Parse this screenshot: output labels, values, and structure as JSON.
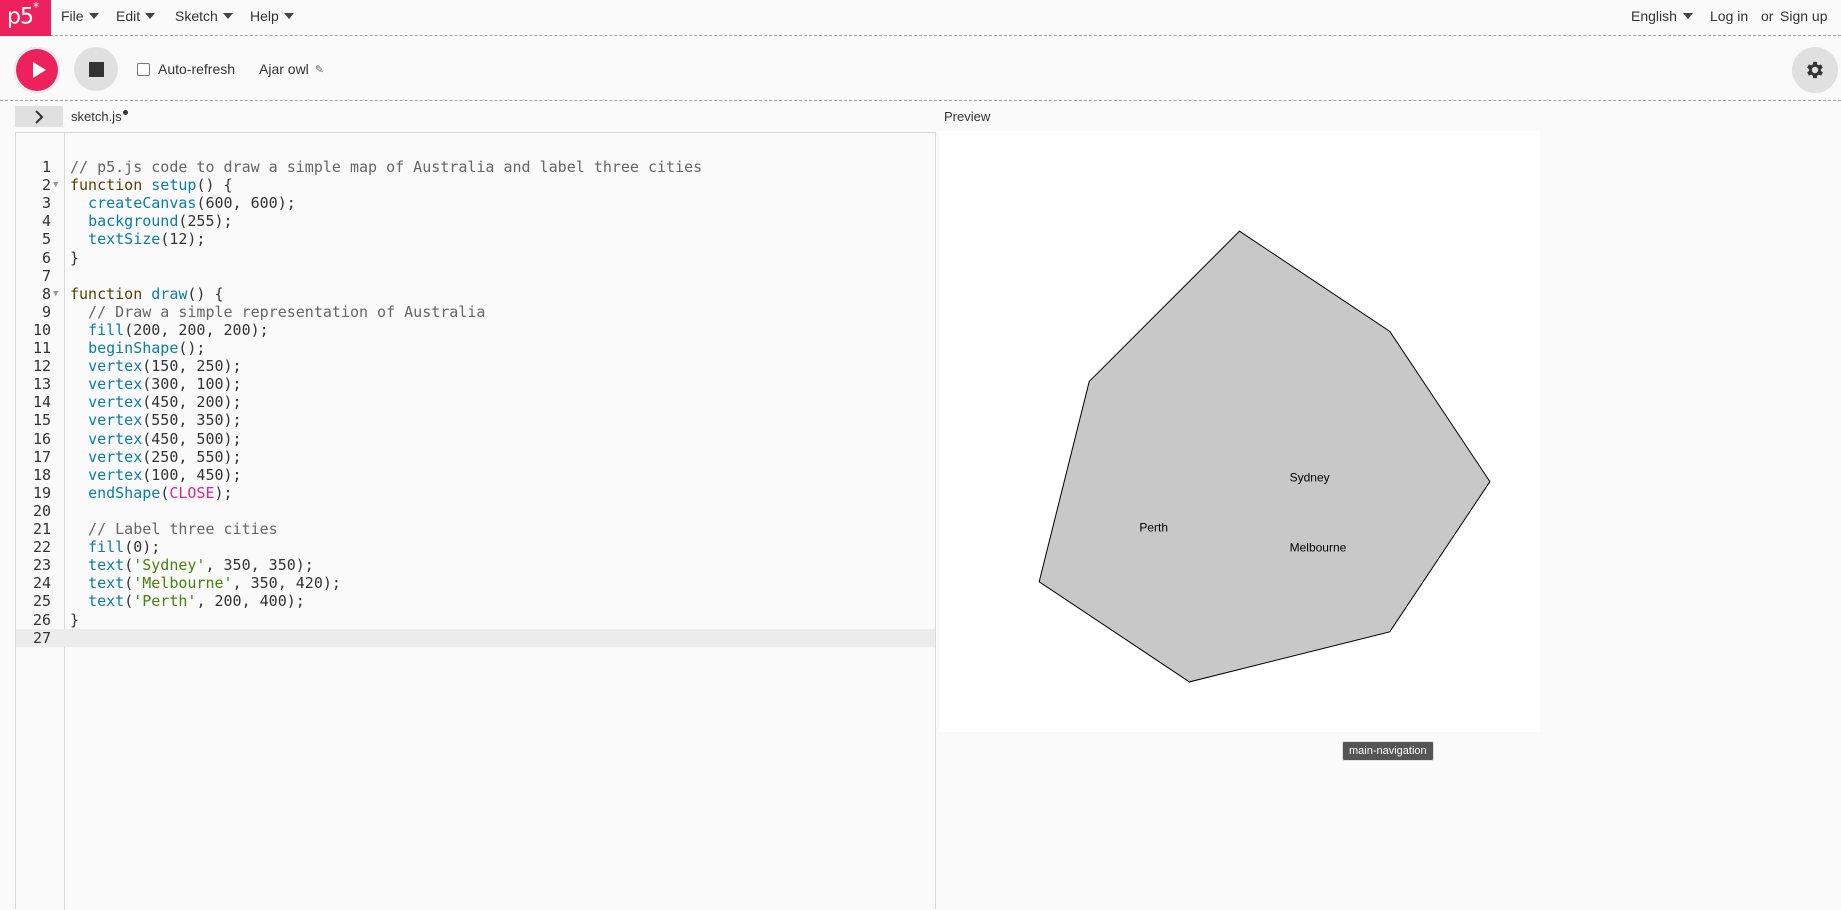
{
  "nav": {
    "logo": "p5",
    "logo_mark": "*",
    "menus": [
      {
        "label": "File"
      },
      {
        "label": "Edit"
      },
      {
        "label": "Sketch"
      },
      {
        "label": "Help"
      }
    ],
    "language": "English",
    "login": "Log in",
    "or": "or",
    "signup": "Sign up"
  },
  "toolbar": {
    "autorefresh_label": "Auto-refresh",
    "sketch_name": "Ajar owl"
  },
  "editor": {
    "filename": "sketch.js",
    "lines": [
      "// p5.js code to draw a simple map of Australia and label three cities",
      "function setup() {",
      "  createCanvas(600, 600);",
      "  background(255);",
      "  textSize(12);",
      "}",
      "",
      "function draw() {",
      "  // Draw a simple representation of Australia",
      "  fill(200, 200, 200);",
      "  beginShape();",
      "  vertex(150, 250);",
      "  vertex(300, 100);",
      "  vertex(450, 200);",
      "  vertex(550, 350);",
      "  vertex(450, 500);",
      "  vertex(250, 550);",
      "  vertex(100, 450);",
      "  endShape(CLOSE);",
      "",
      "  // Label three cities",
      "  fill(0);",
      "  text('Sydney', 350, 350);",
      "  text('Melbourne', 350, 420);",
      "  text('Perth', 200, 400);",
      "}",
      ""
    ]
  },
  "preview": {
    "label": "Preview",
    "cities": {
      "sydney": "Sydney",
      "melbourne": "Melbourne",
      "perth": "Perth"
    }
  },
  "tooltip": "main-navigation",
  "colors": {
    "accent": "#ed225d",
    "shape_fill": "#c8c8c8"
  }
}
